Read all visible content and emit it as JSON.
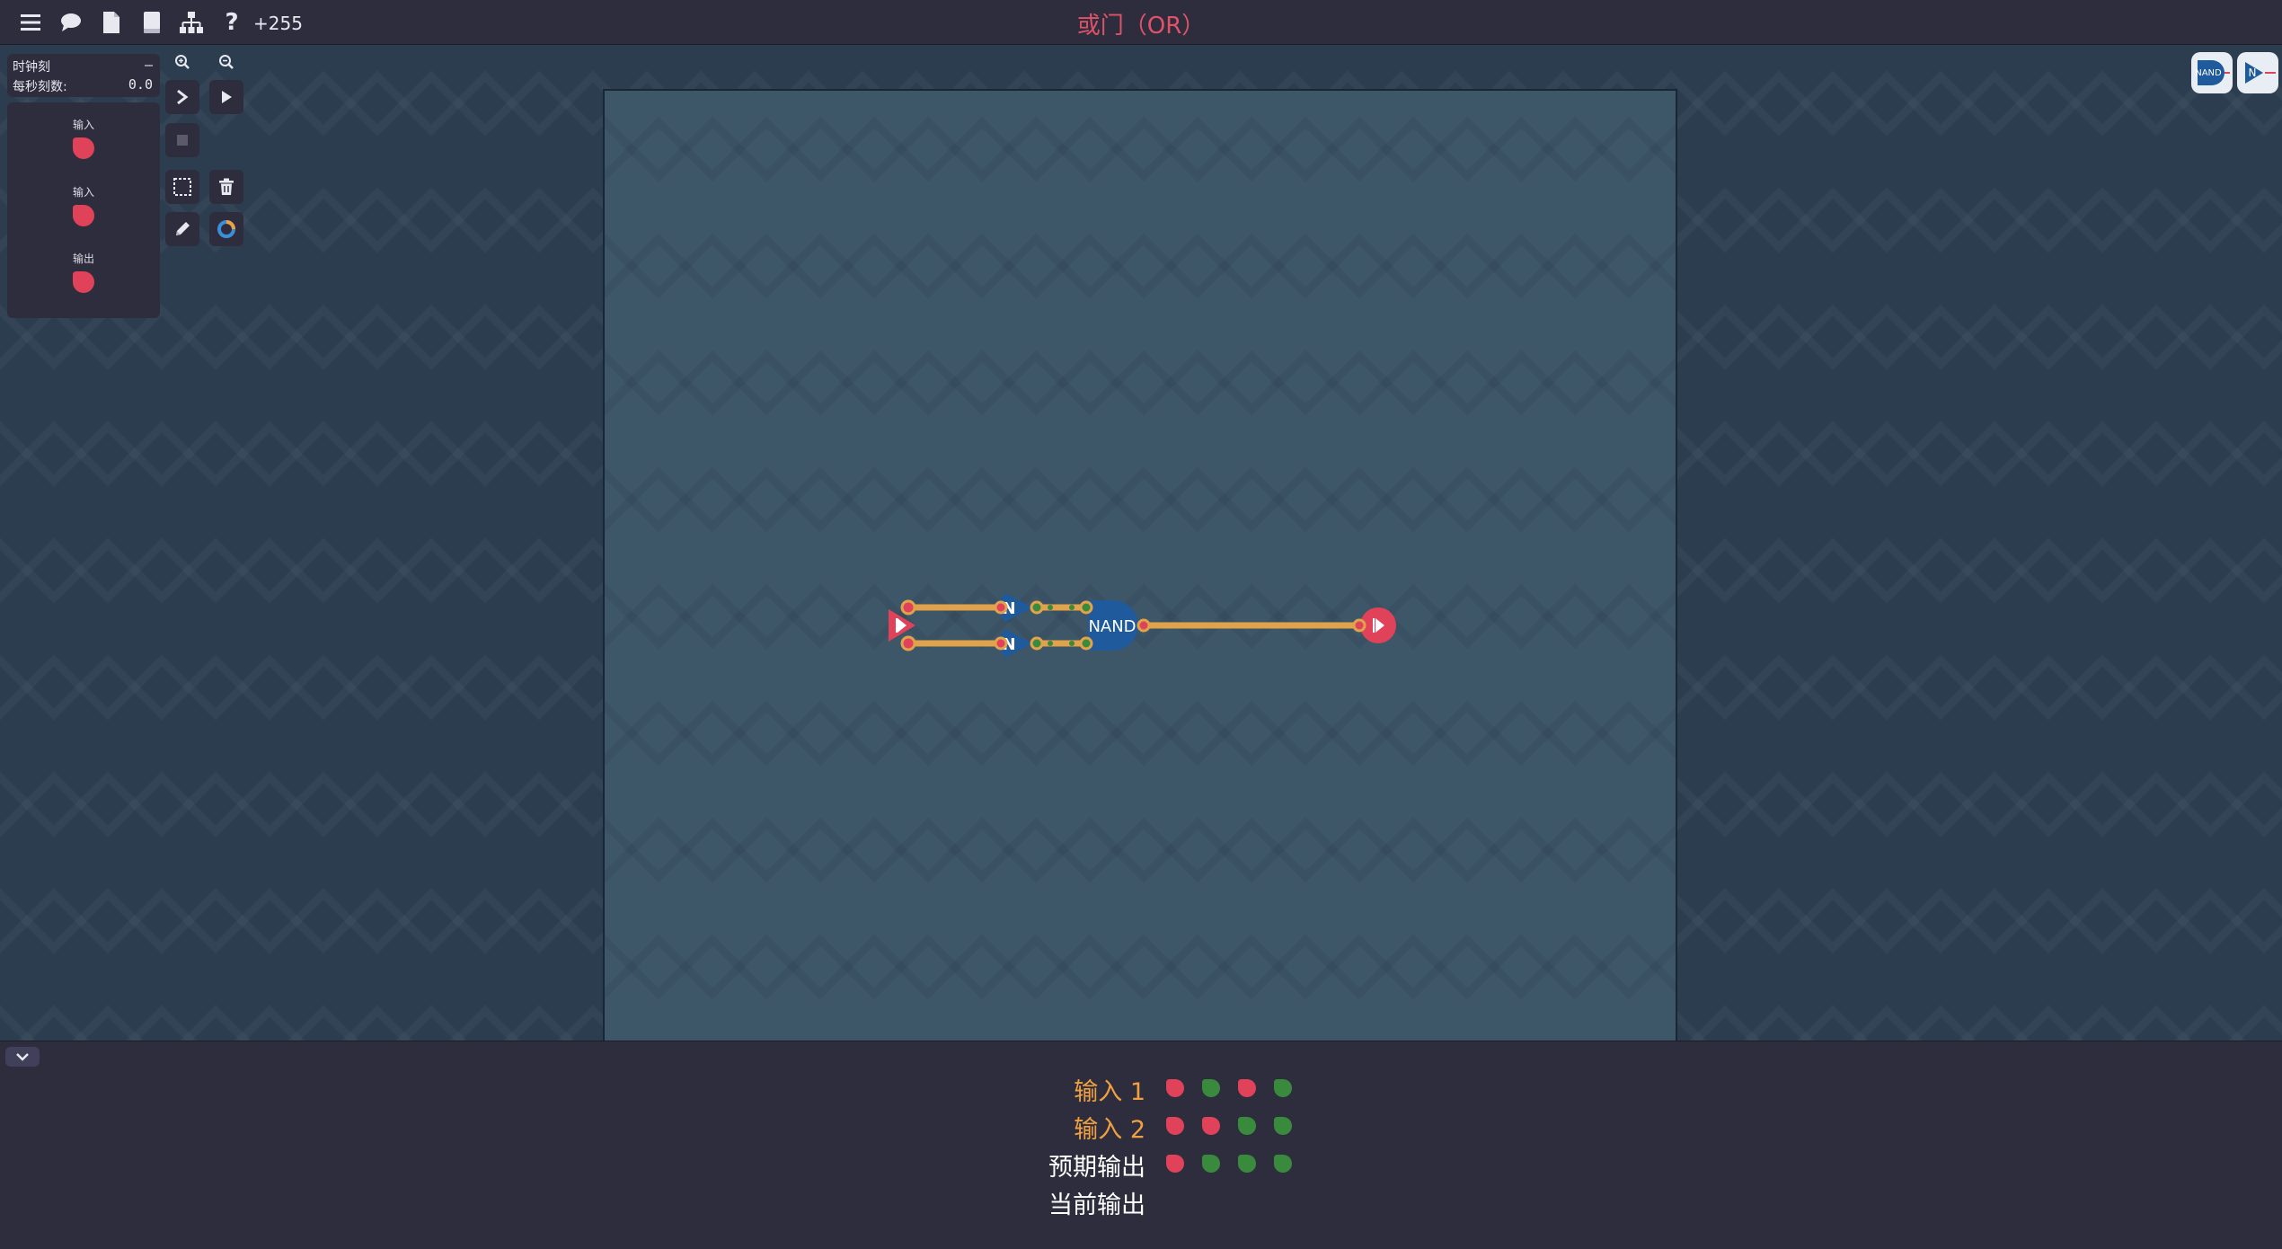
{
  "topbar": {
    "icons": [
      "menu-icon",
      "chat-icon",
      "file-icon",
      "book-icon",
      "hierarchy-icon",
      "help-icon"
    ],
    "score": "+255",
    "level_title": "或门（OR）"
  },
  "clock": {
    "ticks_label": "时钟刻",
    "ticks_value": "–",
    "rate_label": "每秒刻数:",
    "rate_value": "0.0"
  },
  "palette": {
    "items": [
      {
        "label": "输入"
      },
      {
        "label": "输入"
      },
      {
        "label": "输出"
      }
    ]
  },
  "tools": [
    "zoom-in-icon",
    "zoom-out-icon",
    "step-icon",
    "play-icon",
    "stop-icon",
    "select-icon",
    "delete-icon",
    "pencil-icon",
    "color-icon"
  ],
  "chips": {
    "nand_label": "NAND",
    "not_label": "N"
  },
  "circuit": {
    "not_label": "N",
    "nand_label": "NAND"
  },
  "truth_table": {
    "rows": [
      {
        "label": "输入 1",
        "values": [
          0,
          1,
          0,
          1
        ]
      },
      {
        "label": "输入 2",
        "values": [
          0,
          0,
          1,
          1
        ]
      },
      {
        "label": "预期输出",
        "values": [
          0,
          1,
          1,
          1
        ]
      },
      {
        "label": "当前输出",
        "values": []
      }
    ]
  },
  "colors": {
    "off": "#e0425a",
    "on": "#3a8a3e",
    "wire": "#e0a24a",
    "gate": "#1e5a9c",
    "title": "#e05268",
    "input_label": "#f0a040"
  }
}
